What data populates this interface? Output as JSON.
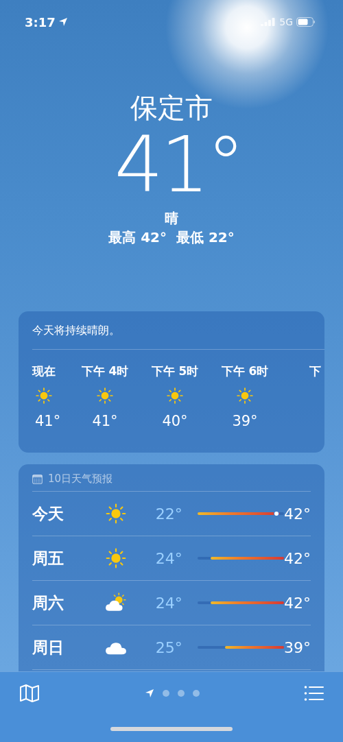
{
  "status_bar": {
    "time": "3:17",
    "network": "5G"
  },
  "location": {
    "city": "保定市",
    "temperature": "41°",
    "condition": "晴",
    "high_low": "最高 42°  最低 22°"
  },
  "hourly": {
    "summary": "今天将持续晴朗。",
    "hours": [
      {
        "time": "现在",
        "kind": "sun",
        "temp": "41°"
      },
      {
        "time": "下午 4时",
        "kind": "sun",
        "temp": "41°"
      },
      {
        "time": "下午 5时",
        "kind": "sun",
        "temp": "40°"
      },
      {
        "time": "下午 6时",
        "kind": "sun",
        "temp": "39°"
      },
      {
        "time": "下",
        "kind": "cut"
      }
    ]
  },
  "daily": {
    "title": "10日天气预报",
    "days": [
      {
        "day": "今天",
        "kind": "sun",
        "low": "22°",
        "high": "42°",
        "level": 0.95,
        "current_marker": true
      },
      {
        "day": "周五",
        "kind": "sun",
        "low": "24°",
        "high": "42°",
        "level": 0.85,
        "current_marker": false
      },
      {
        "day": "周六",
        "kind": "partly_cloudy",
        "low": "24°",
        "high": "42°",
        "level": 0.85,
        "current_marker": false
      },
      {
        "day": "周日",
        "kind": "cloud",
        "low": "25°",
        "high": "39°",
        "level": 0.68,
        "current_marker": false
      }
    ]
  },
  "page_dots": [
    {
      "kind": "location",
      "selected": true
    },
    {
      "kind": "dot",
      "selected": false
    },
    {
      "kind": "dot",
      "selected": false
    },
    {
      "kind": "dot",
      "selected": false
    }
  ]
}
